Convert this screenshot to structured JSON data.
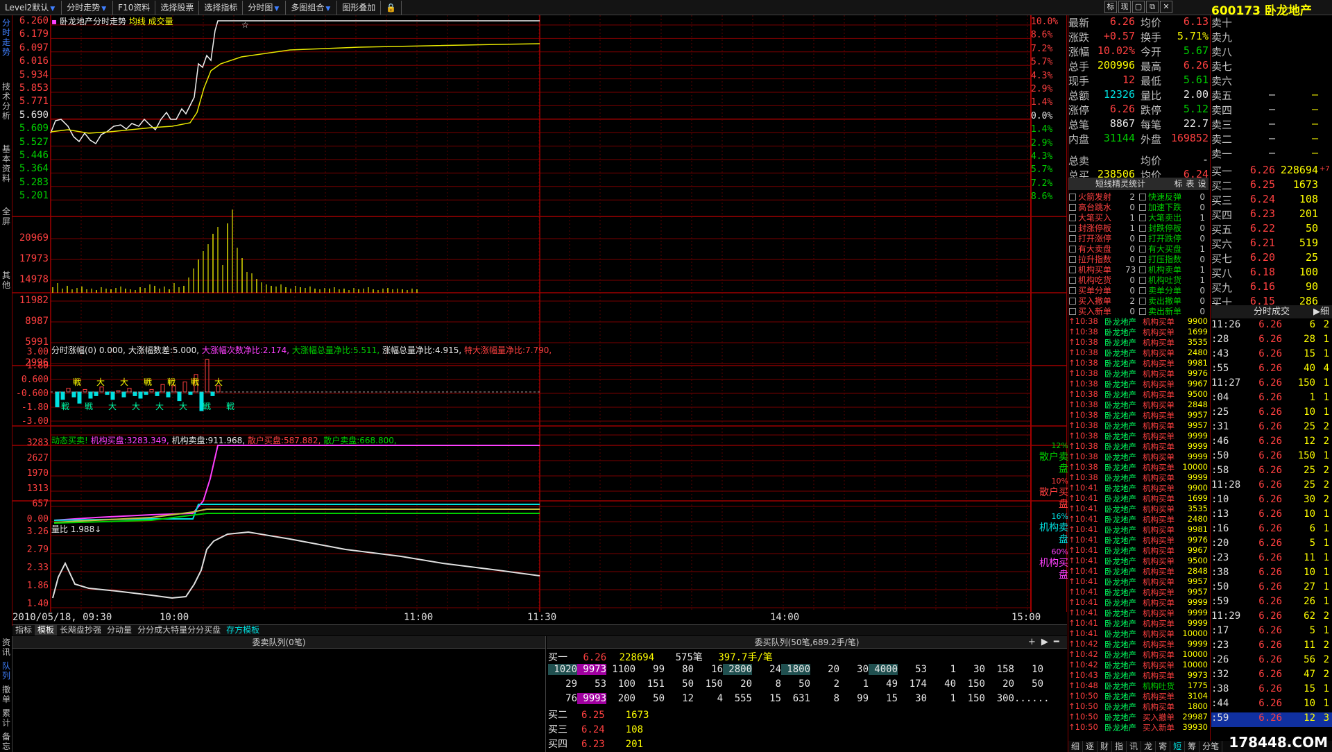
{
  "toolbar": {
    "items": [
      "Level2默认",
      "分时走势",
      "F10资料",
      "选择股票",
      "选择指标",
      "分时图",
      "多图组合",
      "图形叠加"
    ],
    "lock_icon": "lock-icon",
    "right_btns": [
      "标",
      "现"
    ]
  },
  "left_tabs": [
    "分时走势",
    "技术分析",
    "基本资料",
    "全屏",
    "其他"
  ],
  "main_title": {
    "name": "卧龙地产分时走势",
    "avg": "均线",
    "vol": "成交量"
  },
  "price_axis": {
    "left": [
      "6.260",
      "6.179",
      "6.097",
      "6.016",
      "5.934",
      "5.853",
      "5.771",
      "5.690",
      "5.609",
      "5.527",
      "5.446",
      "5.364",
      "5.283",
      "5.201"
    ],
    "right": [
      "10.0%",
      "8.6%",
      "7.2%",
      "5.7%",
      "4.3%",
      "2.9%",
      "1.4%",
      "0.0%",
      "1.4%",
      "2.9%",
      "4.3%",
      "5.7%",
      "7.2%",
      "8.6%"
    ]
  },
  "volume_axis": [
    "20969",
    "17973",
    "14978",
    "11982",
    "8987",
    "5991",
    "2996"
  ],
  "ind1": {
    "title": "分时涨幅(0)",
    "v1": "0.000,",
    "k2": "大涨幅数差:",
    "v2": "5.000,",
    "k3": "大涨幅次数净比:",
    "v3": "2.174,",
    "k4": "大涨幅总量净比:",
    "v4": "5.511,",
    "k5": "涨幅总量净比:",
    "v5": "4.915,",
    "k6": "特大涨幅量净比:",
    "v6": "7.790,",
    "axis": [
      "3.00",
      "1.80",
      "0.600",
      "-0.600",
      "-1.80",
      "-3.00"
    ],
    "marks": [
      "戦",
      "戦",
      "戦",
      "大",
      "大",
      "大",
      "大",
      "戦",
      "大",
      "戦",
      "大",
      "戦",
      "戦",
      "大",
      "戦"
    ]
  },
  "ind2": {
    "title": "动态买卖!",
    "k1": "机构买盘:",
    "v1": "3283.349,",
    "k2": "机构卖盘:",
    "v2": "911.968,",
    "k3": "散户买盘:",
    "v3": "587.882,",
    "k4": "散户卖盘:",
    "v4": "668.800,",
    "axis": [
      "3283",
      "2627",
      "1970",
      "1313",
      "657",
      "0.00"
    ],
    "legend": [
      {
        "pct": "12%",
        "label": "散户卖盘"
      },
      {
        "pct": "10%",
        "label": "散户买盘"
      },
      {
        "pct": "16%",
        "label": "机构卖盘"
      },
      {
        "pct": "60%",
        "label": "机构买盘"
      }
    ]
  },
  "ind3": {
    "title": "量比",
    "v": "1.988↓",
    "axis": [
      "3.26",
      "2.79",
      "2.33",
      "1.86",
      "1.40"
    ]
  },
  "time_axis": [
    "2010/05/18, 09:30",
    "10:00",
    "11:00",
    "11:30",
    "14:00",
    "15:00"
  ],
  "subtabs": [
    "指标",
    "模板",
    "长飚盘抄强",
    "分动量",
    "分分成大特量分分买盘",
    "存方模板"
  ],
  "queue": {
    "sell_header": "委卖队列(0笔)",
    "buy_header": "委买队列(50笔,689.2手/笔)",
    "left_vtabs": [
      "资讯",
      "队列",
      "撤单",
      "累计",
      "备忘"
    ],
    "buy1": {
      "label": "买一",
      "price": "6.26",
      "vol": "228694",
      "count": "575笔",
      "avg": "397.7手/笔"
    },
    "rows": [
      [
        "1020",
        "9973",
        "1100",
        "99",
        "80",
        "16",
        "2800",
        "24",
        "1800",
        "20",
        "30",
        "4000",
        "53",
        "1",
        "30",
        "158",
        "10"
      ],
      [
        "29",
        "53",
        "100",
        "151",
        "50",
        "150",
        "20",
        "8",
        "50",
        "2",
        "1",
        "49",
        "174",
        "40",
        "150",
        "20",
        "50"
      ],
      [
        "76",
        "9993",
        "200",
        "50",
        "12",
        "4",
        "555",
        "15",
        "631",
        "8",
        "99",
        "15",
        "30",
        "1",
        "150",
        "300",
        "......"
      ]
    ],
    "levels": [
      {
        "label": "买二",
        "price": "6.25",
        "vol": "1673"
      },
      {
        "label": "买三",
        "price": "6.24",
        "vol": "108"
      },
      {
        "label": "买四",
        "price": "6.23",
        "vol": "201"
      }
    ]
  },
  "stock": {
    "code": "600173",
    "name": "卧龙地产"
  },
  "quote": [
    {
      "k": "最新",
      "v": "6.26",
      "c": "red",
      "k2": "均价",
      "v2": "6.13",
      "c2": "red"
    },
    {
      "k": "涨跌",
      "v": "+0.57",
      "c": "red",
      "k2": "换手",
      "v2": "5.71%",
      "c2": "yel"
    },
    {
      "k": "涨幅",
      "v": "10.02%",
      "c": "red",
      "k2": "今开",
      "v2": "5.67",
      "c2": "grn"
    },
    {
      "k": "总手",
      "v": "200996",
      "c": "yel",
      "k2": "最高",
      "v2": "6.26",
      "c2": "red"
    },
    {
      "k": "现手",
      "v": "12",
      "c": "red",
      "k2": "最低",
      "v2": "5.61",
      "c2": "grn"
    },
    {
      "k": "总额",
      "v": "12326",
      "c": "cyn",
      "k2": "量比",
      "v2": "2.00",
      "c2": "wht"
    },
    {
      "k": "涨停",
      "v": "6.26",
      "c": "red",
      "k2": "跌停",
      "v2": "5.12",
      "c2": "grn"
    },
    {
      "k": "总笔",
      "v": "8867",
      "c": "wht",
      "k2": "每笔",
      "v2": "22.7",
      "c2": "wht"
    },
    {
      "k": "内盘",
      "v": "31144",
      "c": "grn",
      "k2": "外盘",
      "v2": "169852",
      "c2": "red"
    },
    {
      "k": "总卖",
      "v": "",
      "c": "wht",
      "k2": "均价",
      "v2": "-",
      "c2": "wht"
    },
    {
      "k": "总买",
      "v": "238506",
      "c": "yel",
      "k2": "均价",
      "v2": "6.24",
      "c2": "red"
    }
  ],
  "sells": [
    "卖十",
    "卖九",
    "卖八",
    "卖七",
    "卖六",
    "卖五",
    "卖四",
    "卖三",
    "卖二",
    "卖一"
  ],
  "sell_dash": "–",
  "buys": [
    {
      "n": "买一",
      "p": "6.26",
      "q": "228694"
    },
    {
      "n": "买二",
      "p": "6.25",
      "q": "1673"
    },
    {
      "n": "买三",
      "p": "6.24",
      "q": "108"
    },
    {
      "n": "买四",
      "p": "6.23",
      "q": "201"
    },
    {
      "n": "买五",
      "p": "6.22",
      "q": "50"
    },
    {
      "n": "买六",
      "p": "6.21",
      "q": "519"
    },
    {
      "n": "买七",
      "p": "6.20",
      "q": "25"
    },
    {
      "n": "买八",
      "p": "6.18",
      "q": "100"
    },
    {
      "n": "买九",
      "p": "6.16",
      "q": "90"
    },
    {
      "n": "买十",
      "p": "6.15",
      "q": "286"
    }
  ],
  "buy1_delta": "+7",
  "spirit": {
    "title": "短线精灵统计",
    "tabs": [
      "标",
      "表",
      "设"
    ],
    "left": [
      [
        "火箭发射",
        "2"
      ],
      [
        "高台跳水",
        "0"
      ],
      [
        "大笔买入",
        "1"
      ],
      [
        "封涨停板",
        "1"
      ],
      [
        "打开涨停",
        "0"
      ],
      [
        "有大卖盘",
        "0"
      ],
      [
        "拉升指数",
        "0"
      ],
      [
        "机构买单",
        "73"
      ],
      [
        "机构吃货",
        "0"
      ],
      [
        "买单分单",
        "0"
      ],
      [
        "买入撤单",
        "2"
      ],
      [
        "买入新单",
        "0"
      ]
    ],
    "right": [
      [
        "快速反弹",
        "0"
      ],
      [
        "加速下跌",
        "0"
      ],
      [
        "大笔卖出",
        "1"
      ],
      [
        "封跌停板",
        "0"
      ],
      [
        "打开跌停",
        "0"
      ],
      [
        "有大买盘",
        "1"
      ],
      [
        "打压指数",
        "0"
      ],
      [
        "机构卖单",
        "1"
      ],
      [
        "机构吐货",
        "1"
      ],
      [
        "卖单分单",
        "0"
      ],
      [
        "卖出撤单",
        "0"
      ],
      [
        "卖出新单",
        "0"
      ]
    ]
  },
  "ticker": [
    [
      "10:38",
      "卧龙地产",
      "机构买单",
      "9900"
    ],
    [
      "10:38",
      "卧龙地产",
      "机构买单",
      "1699"
    ],
    [
      "10:38",
      "卧龙地产",
      "机构买单",
      "3535"
    ],
    [
      "10:38",
      "卧龙地产",
      "机构买单",
      "2480"
    ],
    [
      "10:38",
      "卧龙地产",
      "机构买单",
      "9981"
    ],
    [
      "10:38",
      "卧龙地产",
      "机构买单",
      "9976"
    ],
    [
      "10:38",
      "卧龙地产",
      "机构买单",
      "9967"
    ],
    [
      "10:38",
      "卧龙地产",
      "机构买单",
      "9500"
    ],
    [
      "10:38",
      "卧龙地产",
      "机构买单",
      "2848"
    ],
    [
      "10:38",
      "卧龙地产",
      "机构买单",
      "9957"
    ],
    [
      "10:38",
      "卧龙地产",
      "机构买单",
      "9957"
    ],
    [
      "10:38",
      "卧龙地产",
      "机构买单",
      "9999"
    ],
    [
      "10:38",
      "卧龙地产",
      "机构买单",
      "9999"
    ],
    [
      "10:38",
      "卧龙地产",
      "机构买单",
      "9999"
    ],
    [
      "10:38",
      "卧龙地产",
      "机构买单",
      "10000"
    ],
    [
      "10:38",
      "卧龙地产",
      "机构买单",
      "9999"
    ],
    [
      "10:41",
      "卧龙地产",
      "机构买单",
      "9900"
    ],
    [
      "10:41",
      "卧龙地产",
      "机构买单",
      "1699"
    ],
    [
      "10:41",
      "卧龙地产",
      "机构买单",
      "3535"
    ],
    [
      "10:41",
      "卧龙地产",
      "机构买单",
      "2480"
    ],
    [
      "10:41",
      "卧龙地产",
      "机构买单",
      "9981"
    ],
    [
      "10:41",
      "卧龙地产",
      "机构买单",
      "9976"
    ],
    [
      "10:41",
      "卧龙地产",
      "机构买单",
      "9967"
    ],
    [
      "10:41",
      "卧龙地产",
      "机构买单",
      "9500"
    ],
    [
      "10:41",
      "卧龙地产",
      "机构买单",
      "2848"
    ],
    [
      "10:41",
      "卧龙地产",
      "机构买单",
      "9957"
    ],
    [
      "10:41",
      "卧龙地产",
      "机构买单",
      "9957"
    ],
    [
      "10:41",
      "卧龙地产",
      "机构买单",
      "9999"
    ],
    [
      "10:41",
      "卧龙地产",
      "机构买单",
      "9999"
    ],
    [
      "10:41",
      "卧龙地产",
      "机构买单",
      "9999"
    ],
    [
      "10:41",
      "卧龙地产",
      "机构买单",
      "10000"
    ],
    [
      "10:42",
      "卧龙地产",
      "机构买单",
      "9999"
    ],
    [
      "10:42",
      "卧龙地产",
      "机构买单",
      "10000"
    ],
    [
      "10:42",
      "卧龙地产",
      "机构买单",
      "10000"
    ],
    [
      "10:43",
      "卧龙地产",
      "机构买单",
      "9973"
    ],
    [
      "10:48",
      "卧龙地产",
      "机构吐货",
      "1775"
    ],
    [
      "10:50",
      "卧龙地产",
      "机构买单",
      "3104"
    ],
    [
      "10:50",
      "卧龙地产",
      "机构买单",
      "1800"
    ],
    [
      "10:50",
      "卧龙地产",
      "买入撤单",
      "29987"
    ],
    [
      "10:50",
      "卧龙地产",
      "买入新单",
      "39930"
    ]
  ],
  "trades_header": "分时成交",
  "trades": [
    [
      "11:26",
      "6.26",
      "6",
      "2"
    ],
    [
      ":28",
      "6.26",
      "28",
      "1"
    ],
    [
      ":43",
      "6.26",
      "15",
      "1"
    ],
    [
      ":55",
      "6.26",
      "40",
      "4"
    ],
    [
      "11:27",
      "6.26",
      "150",
      "1"
    ],
    [
      ":04",
      "6.26",
      "1",
      "1"
    ],
    [
      ":25",
      "6.26",
      "10",
      "1"
    ],
    [
      ":31",
      "6.26",
      "25",
      "2"
    ],
    [
      ":46",
      "6.26",
      "12",
      "2"
    ],
    [
      ":50",
      "6.26",
      "150",
      "1"
    ],
    [
      ":58",
      "6.26",
      "25",
      "2"
    ],
    [
      "11:28",
      "6.26",
      "25",
      "2"
    ],
    [
      ":10",
      "6.26",
      "30",
      "2"
    ],
    [
      ":13",
      "6.26",
      "10",
      "1"
    ],
    [
      ":16",
      "6.26",
      "6",
      "1"
    ],
    [
      ":20",
      "6.26",
      "5",
      "1"
    ],
    [
      ":23",
      "6.26",
      "11",
      "1"
    ],
    [
      ":38",
      "6.26",
      "10",
      "1"
    ],
    [
      ":50",
      "6.26",
      "27",
      "1"
    ],
    [
      ":59",
      "6.26",
      "26",
      "1"
    ],
    [
      "11:29",
      "6.26",
      "62",
      "2"
    ],
    [
      ":17",
      "6.26",
      "5",
      "1"
    ],
    [
      ":23",
      "6.26",
      "11",
      "2"
    ],
    [
      ":26",
      "6.26",
      "56",
      "2"
    ],
    [
      ":32",
      "6.26",
      "47",
      "2"
    ],
    [
      ":38",
      "6.26",
      "15",
      "1"
    ],
    [
      ":44",
      "6.26",
      "10",
      "1"
    ],
    [
      ":59",
      "6.26",
      "12",
      "3"
    ]
  ],
  "bottom_tabs": [
    "细",
    "逐",
    "财",
    "指",
    "讯",
    "龙",
    "寄",
    "短",
    "筹",
    "分笔"
  ],
  "watermark": "178448.COM"
}
